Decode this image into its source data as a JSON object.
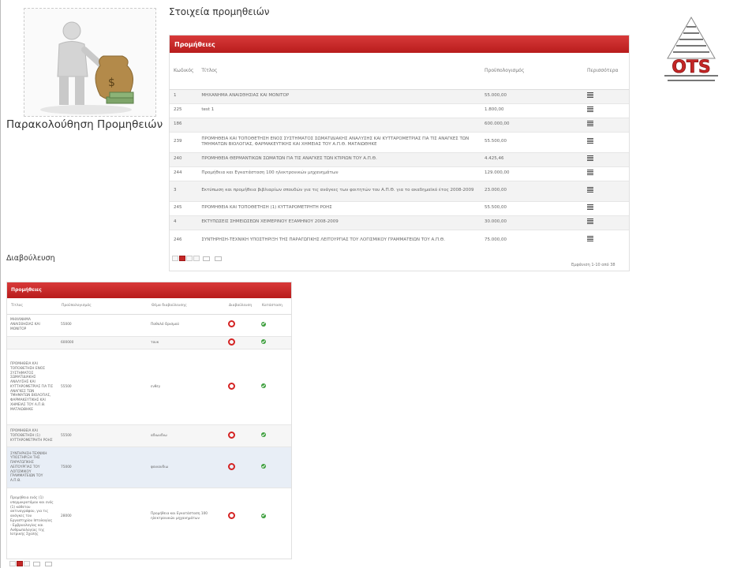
{
  "app": {
    "title": "Παρακολούθηση Προμηθειών"
  },
  "top": {
    "section_title": "Στοιχεία προμηθειών",
    "panel_title": "Προμήθειες",
    "columns": [
      "Κωδικός",
      "Τίτλος",
      "Προϋπολογισμός",
      "Περισσότερα"
    ],
    "rows": [
      {
        "code": "1",
        "title": "ΜΗΧΑΝΗΜΑ ΑΝΑΙΣΘΗΣΙΑΣ ΚΑΙ ΜΟΝΙΤΟΡ",
        "budget": "55.000,00"
      },
      {
        "code": "225",
        "title": "test 1",
        "budget": "1.800,00"
      },
      {
        "code": "186",
        "title": "",
        "budget": "600.000,00"
      },
      {
        "code": "239",
        "title": "ΠΡΟΜΗΘΕΙΑ ΚΑΙ ΤΟΠΟΘΕΤΗΣΗ ΕΝΟΣ ΣΥΣΤΗΜΑΤΟΣ ΣΩΜΑΤΙΔΙΑΚΗΣ ΑΝΑΛΥΣΗΣ ΚΑΙ ΚΥΤΤΑΡΟΜΕΤΡΙΑΣ ΓΙΑ ΤΙΣ ΑΝΑΓΚΕΣ ΤΩΝ ΤΜΗΜΑΤΩΝ ΒΙΟΛΟΓΙΑΣ, ΦΑΡΜΑΚΕΥΤΙΚΗΣ ΚΑΙ ΧΗΜΕΙΑΣ ΤΟΥ Α.Π.Θ. ΜΑΤΑΙΩΘΗΚΕ",
        "budget": "55.500,00"
      },
      {
        "code": "240",
        "title": "ΠΡΟΜΗΘΕΙΑ ΘΕΡΜΑΝΤΙΚΩΝ ΣΩΜΑΤΩΝ ΓΙΑ ΤΙΣ ΑΝΑΓΚΕΣ ΤΩΝ ΚΤΙΡΙΩΝ ΤΟΥ Α.Π.Θ.",
        "budget": "4.425,46"
      },
      {
        "code": "244",
        "title": "Προμήθεια και Εγκατάσταση 100 ηλεκτρονικών μηχανημάτων",
        "budget": "129.000,00"
      },
      {
        "code": "3",
        "title": "Εκτύπωση και προμήθεια βιβλιαρίων σπουδών για τις ανάγκες των φοιτητών του Α.Π.Θ. για το ακαδημαϊκό έτος 2008-2009",
        "budget": "23.000,00"
      },
      {
        "code": "245",
        "title": "ΠΡΟΜΗΘΕΙΑ ΚΑΙ ΤΟΠΟΘΕΤΗΣΗ (1) ΚΥΤΤΑΡΟΜΕΤΡΗΤΗ ΡΟΗΣ",
        "budget": "55.500,00"
      },
      {
        "code": "4",
        "title": "ΕΚΤΥΠΩΣΕΙΣ ΣΗΜΕΙΩΣΕΩΝ ΧΕΙΜΕΡΙΝΟΥ ΕΞΑΜΗΝΟΥ 2008-2009",
        "budget": "30.000,00"
      },
      {
        "code": "246",
        "title": "ΣΥΝΤΗΡΗΣΗ-ΤΕΧΝΙΚΗ ΥΠΟΣΤΗΡΙΞΗ ΤΗΣ ΠΑΡΑΓΩΓΙΚΗΣ ΛΕΙΤΟΥΡΓΙΑΣ ΤΟΥ ΛΟΓΙΣΜΙΚΟΥ ΓΡΑΜΜΑΤΕΙΩΝ ΤΟΥ Α.Π.Θ.",
        "budget": "75.000,00"
      }
    ],
    "footer_info": "Εμφάνιση 1-10 από 38"
  },
  "bottom": {
    "section_title": "Διαβούλευση",
    "panel_title": "Προμήθειες",
    "columns": [
      "Τίτλος",
      "Προϋπολογισμός",
      "Θέμα διαβούλευσης",
      "Διαβούλευση",
      "Κατάσταση"
    ],
    "rows": [
      {
        "title": "ΜΗΧΑΝΗΜΑ ΑΝΑΙΣΘΗΣΙΑΣ ΚΑΙ ΜΟΝΙΤΟΡ",
        "budget": "55000",
        "topic": "Παθολό Ορισμού"
      },
      {
        "title": "",
        "budget": "600000",
        "topic": "τουκ"
      },
      {
        "title": "ΠΡΟΜΗΘΕΙΑ ΚΑΙ ΤΟΠΟΘΕΤΗΣΗ ΕΝΟΣ ΣΥΣΤΗΜΑΤΟΣ ΣΩΜΑΤΙΔΙΑΚΗΣ ΑΝΑΛΥΣΗΣ ΚΑΙ ΚΥΤΤΑΡΟΜΕΤΡΙΑΣ ΓΙΑ ΤΙΣ ΑΝΑΓΚΕΣ ΤΩΝ ΤΜΗΜΑΤΩΝ ΒΙΟΛΟΓΙΑΣ, ΦΑΡΜΑΚΕΥΤΙΚΗΣ ΚΑΙ ΧΗΜΕΙΑΣ ΤΟΥ Α.Π.Θ. ΜΑΤΑΙΩΘΗΚΕ",
        "budget": "55500",
        "topic": "ενθεγ"
      },
      {
        "title": "ΠΡΟΜΗΘΕΙΑ ΚΑΙ ΤΟΠΟΘΕΤΗΣΗ (1) ΚΥΤΤΑΡΟΜΕΤΡΗΤΗ ΡΟΗΣ",
        "budget": "55500",
        "topic": "αδιωυδιω"
      },
      {
        "title": "ΣΥΝΤΗΡΗΣΗ-ΤΕΧΝΙΚΗ ΥΠΟΣΤΗΡΙΞΗ ΤΗΣ ΠΑΡΑΓΩΓΙΚΗΣ ΛΕΙΤΟΥΡΓΙΑΣ ΤΟΥ ΛΟΓΙΣΜΙΚΟΥ ΓΡΑΜΜΑΤΕΙΩΝ ΤΟΥ Α.Π.Θ.",
        "budget": "75000",
        "topic": "φουιουδιω"
      },
      {
        "title": "Προμήθεια ενός (1) υπερμικροτόμου και ενός (1) κάθετου ακτινογράφου, για τις ανάγκες του Εργαστηρίου Ιστολογίας - Εμβρυολογίας και Ανθρωπολογίας της Ιατρικής Σχολής",
        "budget": "28000",
        "topic": "Προμήθεια και Εγκατάσταση 100 ηλεκτρονικών μηχανημάτων"
      }
    ]
  },
  "logo": {
    "text": "OTS"
  },
  "colors": {
    "accent": "#c32626",
    "accent_dark": "#a01818",
    "ok": "#3fa03f"
  }
}
